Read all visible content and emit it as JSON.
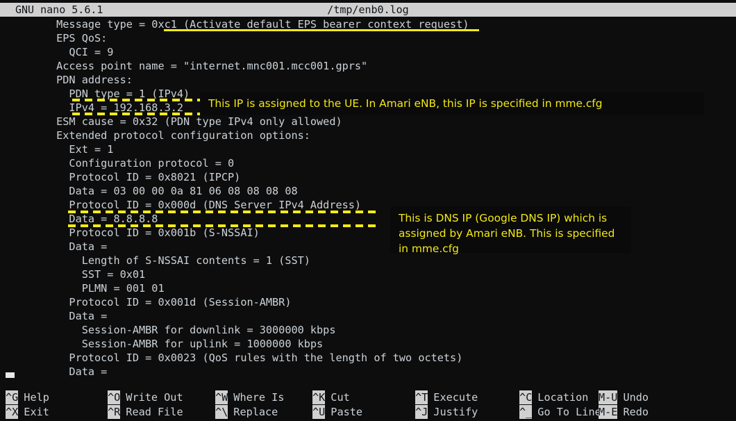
{
  "titlebar": {
    "app": "GNU nano 5.6.1",
    "filename": "/tmp/enb0.log"
  },
  "editor": {
    "lines": [
      "        Message type = 0xc1 (Activate default EPS bearer context request)",
      "        EPS QoS:",
      "          QCI = 9",
      "        Access point name = \"internet.mnc001.mcc001.gprs\"",
      "        PDN address:",
      "          PDN type = 1 (IPv4)",
      "          IPv4 = 192.168.3.2",
      "        ESM cause = 0x32 (PDN type IPv4 only allowed)",
      "        Extended protocol configuration options:",
      "          Ext = 1",
      "          Configuration protocol = 0",
      "          Protocol ID = 0x8021 (IPCP)",
      "          Data = 03 00 00 0a 81 06 08 08 08 08",
      "          Protocol ID = 0x000d (DNS Server IPv4 Address)",
      "          Data = 8.8.8.8",
      "          Protocol ID = 0x001b (S-NSSAI)",
      "          Data =",
      "            Length of S-NSSAI contents = 1 (SST)",
      "            SST = 0x01",
      "            PLMN = 001 01",
      "          Protocol ID = 0x001d (Session-AMBR)",
      "          Data =",
      "            Session-AMBR for downlink = 3000000 kbps",
      "            Session-AMBR for uplink = 1000000 kbps",
      "          Protocol ID = 0x0023 (QoS rules with the length of two octets)",
      "          Data ="
    ]
  },
  "annotations": {
    "note_ip": "This IP is assigned to the UE. In Amari eNB, this IP is specified in mme.cfg",
    "note_dns": "This is DNS IP (Google DNS IP) which is assigned by Amari eNB. This is specified in mme.cfg",
    "highlight_color": "#f5ec14",
    "note_text_color": "#f2e914",
    "note_bg_color": "#0a0a0a"
  },
  "helpbar": {
    "row1": [
      {
        "key": "^G",
        "label": "Help"
      },
      {
        "key": "^O",
        "label": "Write Out"
      },
      {
        "key": "^W",
        "label": "Where Is"
      },
      {
        "key": "^K",
        "label": "Cut"
      },
      {
        "key": "^T",
        "label": "Execute"
      },
      {
        "key": "^C",
        "label": "Location"
      },
      {
        "key": "M-U",
        "label": "Undo"
      }
    ],
    "row2": [
      {
        "key": "^X",
        "label": "Exit"
      },
      {
        "key": "^R",
        "label": "Read File"
      },
      {
        "key": "^\\",
        "label": "Replace"
      },
      {
        "key": "^U",
        "label": "Paste"
      },
      {
        "key": "^J",
        "label": "Justify"
      },
      {
        "key": "^_",
        "label": "Go To Line"
      },
      {
        "key": "M-E",
        "label": "Redo"
      }
    ]
  }
}
